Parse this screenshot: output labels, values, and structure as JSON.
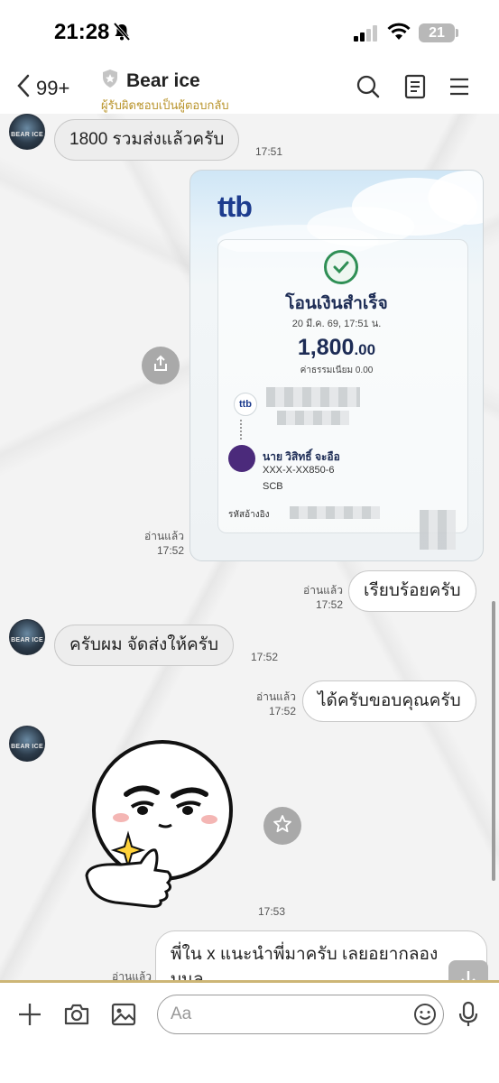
{
  "status_bar": {
    "time": "21:28",
    "battery": "21"
  },
  "header": {
    "back_count": "99+",
    "title": "Bear ice",
    "subtitle": "ผู้รับผิดชอบเป็นผู้ตอบกลับ"
  },
  "avatar": {
    "label": "BEAR ICE"
  },
  "messages": [
    {
      "text": "1800 รวมส่งแล้วครับ",
      "time": "17:51"
    },
    {
      "read": "อ่านแล้ว",
      "time": "17:52"
    },
    {
      "text": "เรียบร้อยครับ",
      "read": "อ่านแล้ว",
      "time": "17:52"
    },
    {
      "text": "ครับผม จัดส่งให้ครับ",
      "time": "17:52"
    },
    {
      "text": "ได้ครับขอบคุณครับ",
      "read": "อ่านแล้ว",
      "time": "17:52"
    },
    {
      "time": "17:53"
    },
    {
      "text": "พี่ใน x แนะนำพี่มาครับ เลยอยากลอง บนล",
      "read": "อ่านแล้ว"
    }
  ],
  "slip": {
    "brand": "ttb",
    "title": "โอนเงินสำเร็จ",
    "date": "20 มี.ค. 69, 17:51 น.",
    "amount_main": "1,800",
    "amount_dec": ".00",
    "fee": "ค่าธรรมเนียม  0.00",
    "mini_logo": "ttb",
    "receiver_name": "นาย วิสิทธิ์ จะอือ",
    "receiver_account": "XXX-X-XX850-6",
    "receiver_bank": "SCB",
    "ref_label": "รหัสอ้างอิง"
  },
  "input": {
    "placeholder": "Aa"
  },
  "colors": {
    "accent_gold": "#b9942b",
    "bubble_in": "#ededed",
    "bubble_out": "#ffffff",
    "slip_brand": "#1d3c8e"
  },
  "icons": {
    "header": [
      "chevron-left-icon",
      "shield-icon",
      "search-icon",
      "notes-icon",
      "menu-icon"
    ],
    "input_bar": [
      "plus-icon",
      "camera-icon",
      "image-icon",
      "emoji-icon",
      "microphone-icon"
    ],
    "chat": [
      "share-icon",
      "star-icon",
      "arrow-down-icon"
    ]
  }
}
